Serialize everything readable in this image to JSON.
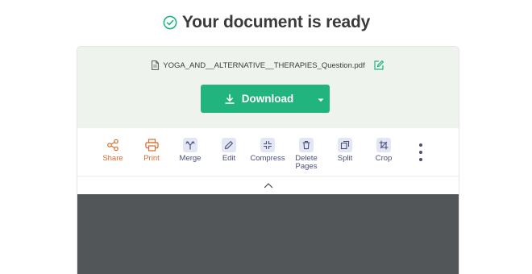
{
  "header": {
    "title": "Your document is ready",
    "icon": "check-circle-icon",
    "icon_color": "#21b47e"
  },
  "file": {
    "name": "YOGA_AND__ALTERNATIVE__THERAPIES_Question.pdf",
    "file_icon": "document-icon",
    "rename_icon": "edit-icon"
  },
  "download": {
    "label": "Download",
    "icon": "download-icon",
    "caret_icon": "caret-down-icon",
    "color": "#21b47e"
  },
  "tools": [
    {
      "id": "share",
      "label": "Share",
      "icon": "share-icon",
      "color": "#d9692c"
    },
    {
      "id": "print",
      "label": "Print",
      "icon": "printer-icon",
      "color": "#d9692c"
    },
    {
      "id": "merge",
      "label": "Merge",
      "icon": "merge-icon",
      "color": "#4a4f7a"
    },
    {
      "id": "edit",
      "label": "Edit",
      "icon": "pencil-icon",
      "color": "#4a4f7a"
    },
    {
      "id": "compress",
      "label": "Compress",
      "icon": "compress-icon",
      "color": "#4a4f7a"
    },
    {
      "id": "delete",
      "label": "Delete Pages",
      "icon": "trash-icon",
      "color": "#4a4f7a"
    },
    {
      "id": "split",
      "label": "Split",
      "icon": "split-icon",
      "color": "#4a4f7a"
    },
    {
      "id": "crop",
      "label": "Crop",
      "icon": "crop-icon",
      "color": "#4a4f7a"
    }
  ],
  "more": {
    "icon": "more-vertical-icon"
  },
  "collapse": {
    "icon": "chevron-up-icon"
  },
  "colors": {
    "accent_green": "#21b47e",
    "panel_bg": "#eef3ee",
    "preview_bg": "#525659",
    "tool_text": "#4a4f7a",
    "tool_text_orange": "#d9692c"
  }
}
